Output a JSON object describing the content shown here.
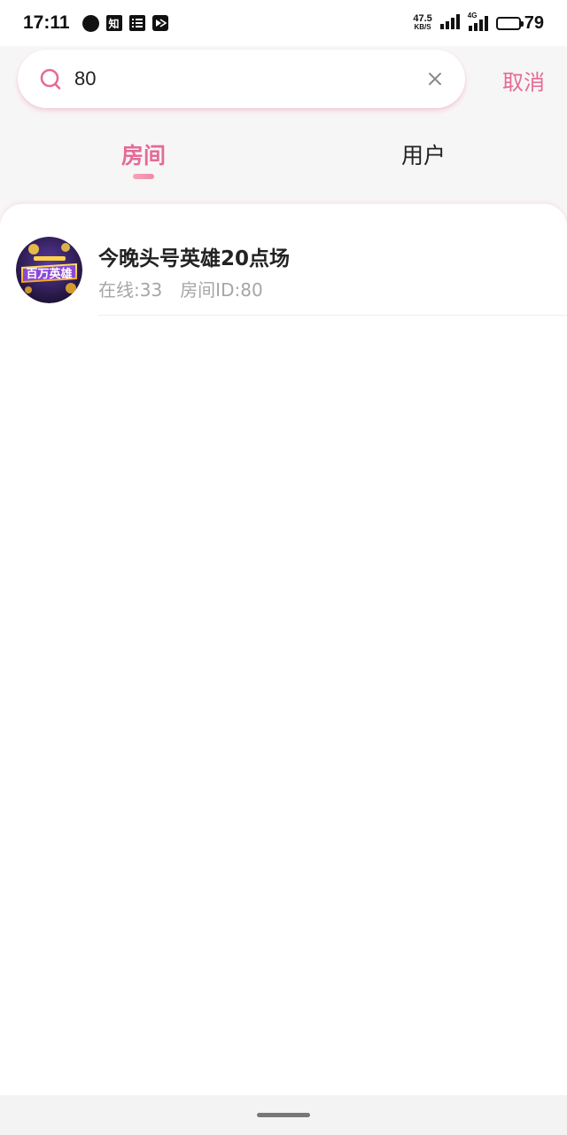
{
  "status_bar": {
    "time": "17:11",
    "app_icons": [
      "chat-bubble-icon",
      "zhihu-icon",
      "list-icon",
      "cast-icon"
    ],
    "zhihu_glyph": "知",
    "net_speed_value": "47.5",
    "net_speed_unit": "KB/S",
    "signal_label": "4G",
    "battery_level": "79"
  },
  "search": {
    "query": "80",
    "placeholder": "",
    "cancel_label": "取消"
  },
  "tabs": [
    {
      "label": "房间",
      "active": true
    },
    {
      "label": "用户",
      "active": false
    }
  ],
  "results": [
    {
      "title": "今晚头号英雄20点场",
      "online": "在线:33",
      "room_id": "房间ID:80",
      "avatar_text": "百万英雄"
    }
  ],
  "colors": {
    "accent": "#e46b95",
    "text_primary": "#222222",
    "text_secondary": "#a6a6a6",
    "background": "#f7f6f7"
  }
}
